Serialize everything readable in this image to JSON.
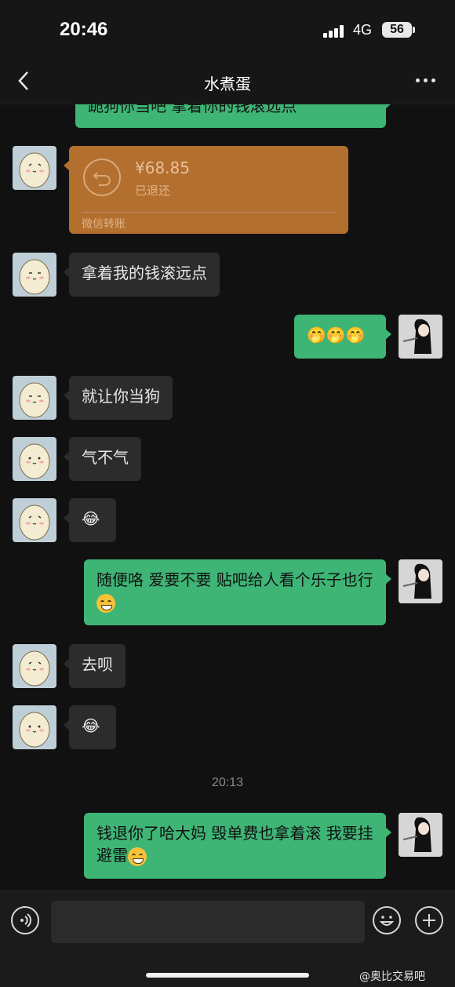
{
  "status_bar": {
    "time": "20:46",
    "network": "4G",
    "battery": "56"
  },
  "nav": {
    "title": "水煮蛋"
  },
  "messages": {
    "m0": {
      "sender": "me",
      "text": "跪狗你当吧 拿着你的钱滚远点"
    },
    "transfer": {
      "sender": "other",
      "amount": "¥68.85",
      "status": "已退还",
      "label": "微信转账"
    },
    "m2": {
      "sender": "other",
      "text": "拿着我的钱滚远点"
    },
    "m3": {
      "sender": "me",
      "text": "🤭🤭🤭"
    },
    "m4": {
      "sender": "other",
      "text": "就让你当狗"
    },
    "m5": {
      "sender": "other",
      "text": "气不气"
    },
    "m6": {
      "sender": "other",
      "text": "😂"
    },
    "m7": {
      "sender": "me",
      "text": "随便咯 爱要不要 贴吧给人看个乐子也行"
    },
    "m8": {
      "sender": "other",
      "text": "去呗"
    },
    "m9": {
      "sender": "other",
      "text": "😂"
    },
    "timestamp": "20:13",
    "m10": {
      "sender": "me",
      "text": "钱退你了哈大妈 毁单费也拿着滚 我要挂避雷"
    }
  },
  "input": {
    "placeholder": ""
  },
  "watermark": "@奥比交易吧",
  "colors": {
    "out_bubble": "#3eb575",
    "in_bubble": "#2c2c2c",
    "transfer": "#b36f2e",
    "background": "#111111"
  }
}
